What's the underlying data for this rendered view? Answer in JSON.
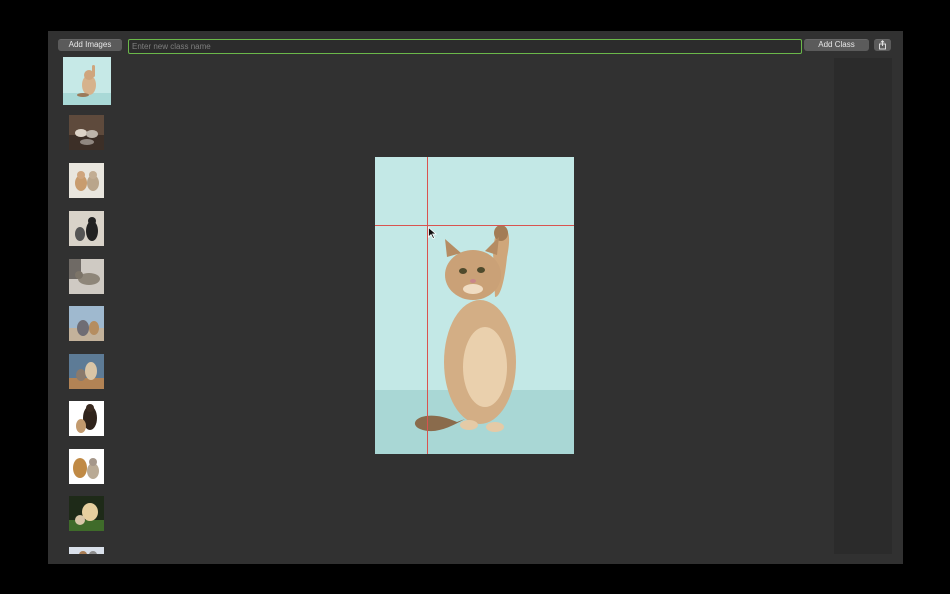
{
  "toolbar": {
    "add_images_label": "Add Images",
    "class_input_placeholder": "Enter new class name",
    "class_input_value": "",
    "add_class_label": "Add Class",
    "share_icon": "share-icon"
  },
  "thumbnails": [
    {
      "name": "kitten-teal",
      "selected": true
    },
    {
      "name": "kittens-on-sofa",
      "selected": false
    },
    {
      "name": "cat-and-dog-white",
      "selected": false
    },
    {
      "name": "cats-black-white",
      "selected": false
    },
    {
      "name": "cat-lying-bed",
      "selected": false
    },
    {
      "name": "dog-cat-window",
      "selected": false
    },
    {
      "name": "dog-and-cat-table",
      "selected": false
    },
    {
      "name": "dog-black-kitten",
      "selected": false
    },
    {
      "name": "cats-and-dog-white",
      "selected": false
    },
    {
      "name": "dog-and-puppy-grass",
      "selected": false
    },
    {
      "name": "partial-thumbnail",
      "selected": false
    }
  ],
  "colors": {
    "accent_input_border": "#6bb84a",
    "guide_lines": "#d9534f",
    "canvas_background": "#c3e8e6"
  }
}
